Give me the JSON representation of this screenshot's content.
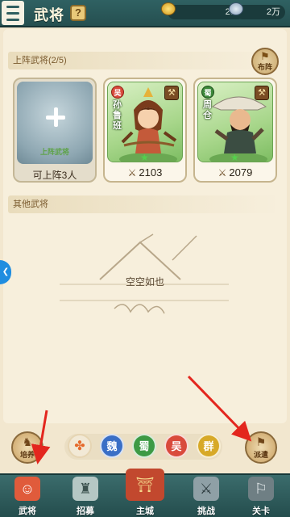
{
  "header": {
    "title": "武将",
    "help_label": "?",
    "gold": "200",
    "tokens": "2万"
  },
  "lineup": {
    "section_title": "上阵武将(2/5)",
    "arrange_label": "布阵",
    "empty_slot": {
      "hint": "上阵武将",
      "label": "可上阵3人"
    },
    "heroes": [
      {
        "name": "孙鲁班",
        "faction": "吴",
        "power": "2103"
      },
      {
        "name": "周仓",
        "faction": "蜀",
        "power": "2079"
      }
    ]
  },
  "others": {
    "section_title": "其他武将",
    "empty_text": "空空如也"
  },
  "actions": {
    "left_label": "培养",
    "right_label": "派遣"
  },
  "filters": {
    "all_icon": "✤",
    "wei": "魏",
    "shu": "蜀",
    "wu": "吴",
    "qun": "群"
  },
  "nav": [
    {
      "label": "武将",
      "icon": "general-icon"
    },
    {
      "label": "招募",
      "icon": "recruit-icon"
    },
    {
      "label": "主城",
      "icon": "city-icon"
    },
    {
      "label": "挑战",
      "icon": "challenge-icon"
    },
    {
      "label": "关卡",
      "icon": "stage-icon"
    }
  ],
  "colors": {
    "header_bg": "#2f6162",
    "panel_bg": "#f7efdc",
    "annotation_arrow": "#e3261e"
  }
}
